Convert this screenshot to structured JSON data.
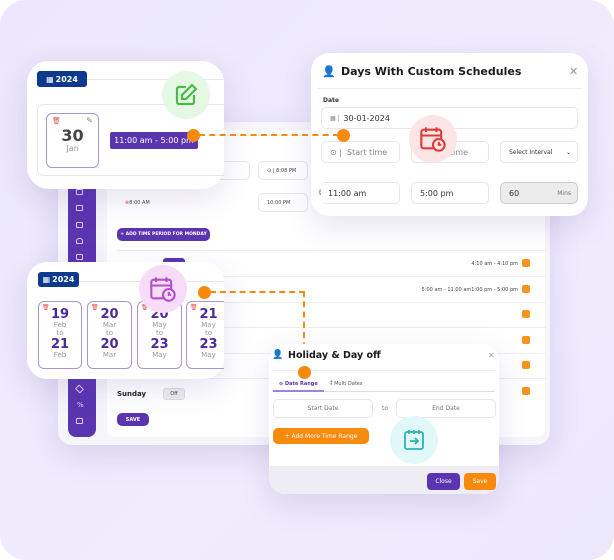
{
  "colors": {
    "background": "#ebe6fb",
    "primary": "#5b35b0",
    "navy": "#0d3a8c",
    "accent": "#f7890c",
    "danger": "#e05050"
  },
  "schedule_panel": {
    "time_row1": {
      "right": "8:08 PM"
    },
    "time_row2": {
      "left": "8:00 AM",
      "right": "10:00 PM"
    },
    "add_period_label": "+ ADD TIME PERIOD FOR MONDAY",
    "rows": [
      {
        "times": "4:10 am - 4:10 pm"
      },
      {
        "times": "5:00 am - 11:00 am1:00 pm - 5:00 pm"
      },
      {
        "times": ""
      },
      {
        "times": ""
      },
      {
        "times": ""
      },
      {
        "times": ""
      }
    ],
    "sunday_label": "Sunday",
    "sunday_toggle": "Off",
    "save_label": "SAVE"
  },
  "custom_date_card": {
    "year": "2024",
    "day": "30",
    "month": "Jan",
    "time_range": "11:00 am - 5:00 pm"
  },
  "custom_schedule_dialog": {
    "title": "Days With Custom Schedules",
    "date_label": "Date",
    "date_value": "30-01-2024",
    "start_time_placeholder": "Start time",
    "end_time_placeholder": "End time",
    "interval_placeholder": "Select Interval",
    "start_value": "11:00 am",
    "end_value": "5:00 pm",
    "interval_value": "60",
    "interval_unit": "Mins"
  },
  "holiday_card": {
    "year": "2024",
    "ranges": [
      {
        "from_day": "19",
        "from_month": "Feb",
        "to": "to",
        "to_day": "21",
        "to_month": "Feb"
      },
      {
        "from_day": "20",
        "from_month": "Mar",
        "to": "to",
        "to_day": "20",
        "to_month": "Mar"
      },
      {
        "from_day": "20",
        "from_month": "May",
        "to": "to",
        "to_day": "23",
        "to_month": "May"
      },
      {
        "from_day": "21",
        "from_month": "May",
        "to": "to",
        "to_day": "23",
        "to_month": "May"
      }
    ]
  },
  "holiday_dialog": {
    "title": "Holiday & Day off",
    "tabs": [
      {
        "label": "Date Range",
        "active": true
      },
      {
        "label": "Multi Dates",
        "active": false
      }
    ],
    "start_placeholder": "Start Date",
    "to_label": "to",
    "end_placeholder": "End Date",
    "add_range_label": "+ Add More Time Range",
    "close_label": "Close",
    "save_label": "Save"
  }
}
